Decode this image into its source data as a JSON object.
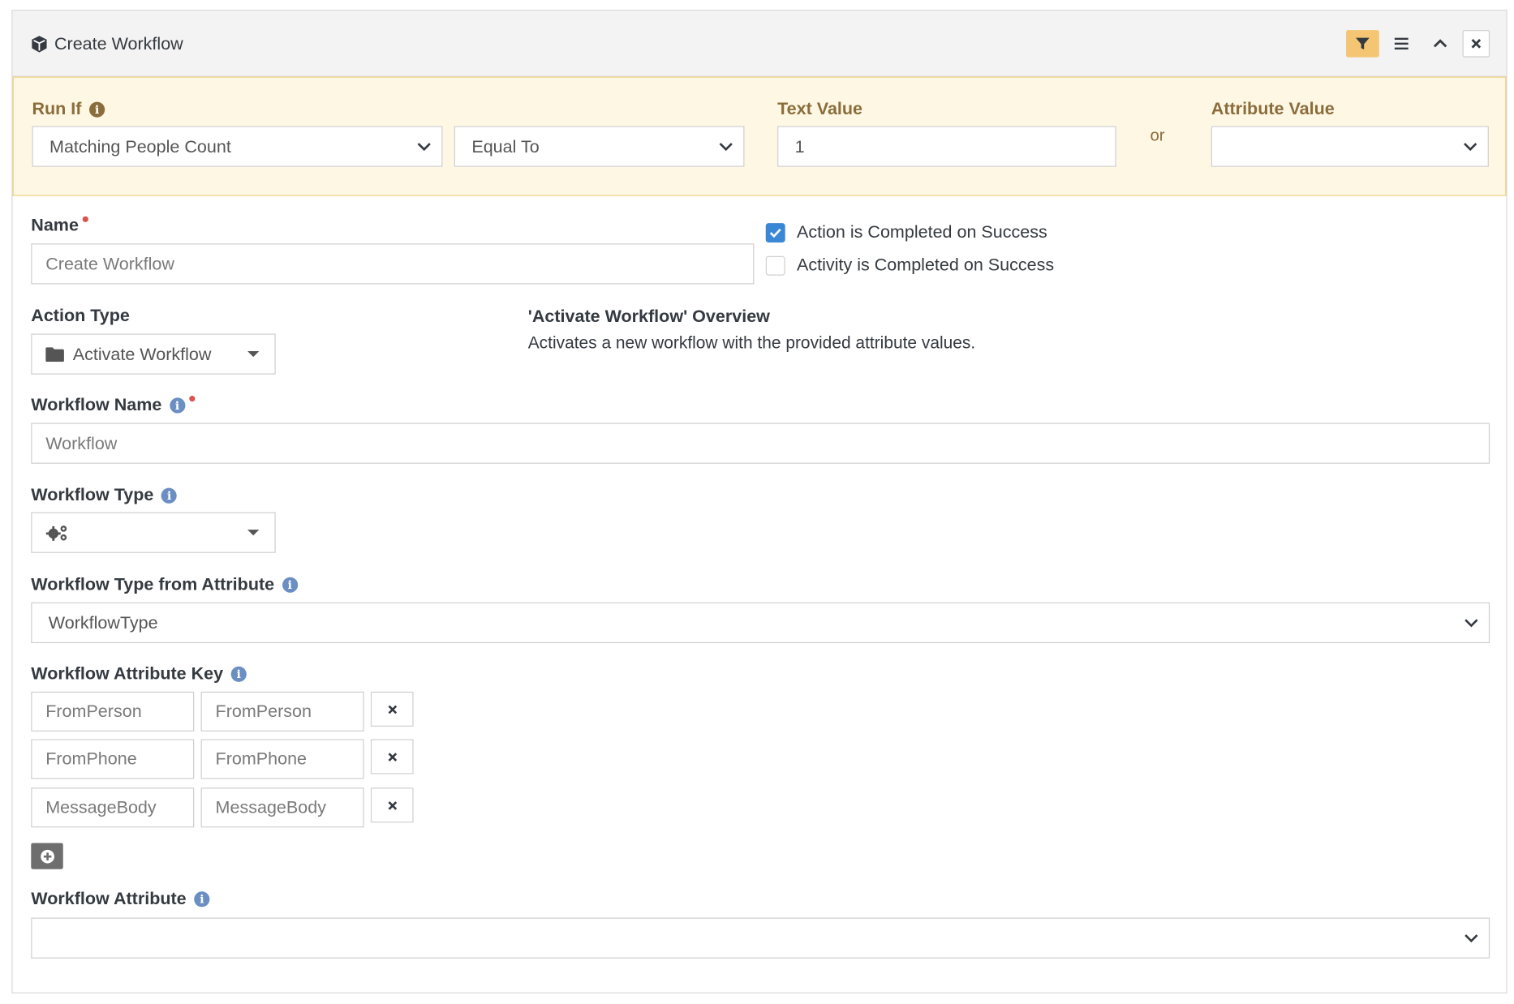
{
  "panel": {
    "title": "Create Workflow",
    "icons": [
      "cube-icon",
      "filter-icon",
      "menu-icon",
      "chevron-up-icon",
      "close-icon"
    ]
  },
  "run_if": {
    "label": "Run If",
    "field": "Matching People Count",
    "operator": "Equal To",
    "text_value_label": "Text Value",
    "text_value": "1",
    "or": "or",
    "attribute_value_label": "Attribute Value",
    "attribute_value": ""
  },
  "name": {
    "label": "Name",
    "value": "Create Workflow"
  },
  "completion": {
    "action_label": "Action is Completed on Success",
    "action_checked": true,
    "activity_label": "Activity is Completed on Success",
    "activity_checked": false
  },
  "action_type": {
    "label": "Action Type",
    "value": "Activate Workflow"
  },
  "overview": {
    "title": "'Activate Workflow' Overview",
    "description": "Activates a new workflow with the provided attribute values."
  },
  "workflow_name": {
    "label": "Workflow Name",
    "value": "Workflow"
  },
  "workflow_type": {
    "label": "Workflow Type",
    "value": ""
  },
  "workflow_type_from_attribute": {
    "label": "Workflow Type from Attribute",
    "value": "WorkflowType"
  },
  "attribute_key": {
    "label": "Workflow Attribute Key",
    "rows": [
      {
        "key": "FromPerson",
        "value": "FromPerson"
      },
      {
        "key": "FromPhone",
        "value": "FromPhone"
      },
      {
        "key": "MessageBody",
        "value": "MessageBody"
      }
    ]
  },
  "workflow_attribute": {
    "label": "Workflow Attribute",
    "value": ""
  },
  "colors": {
    "run_if_bg": "#fdf7e4",
    "run_if_label": "#8a6d3b",
    "filter_active": "#f4c673",
    "checkbox_on": "#3a87d5",
    "required": "#d9534f",
    "info": "#6b8ec3"
  }
}
